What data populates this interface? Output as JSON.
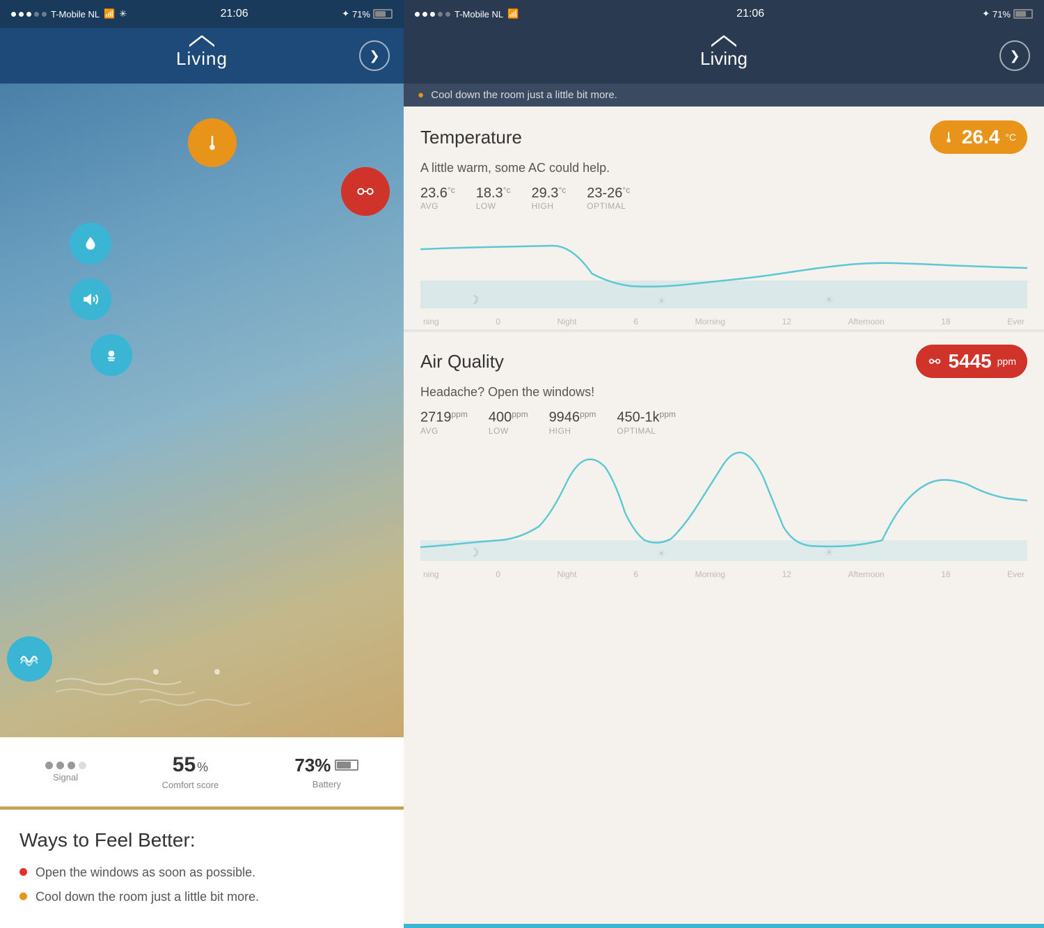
{
  "left": {
    "status": {
      "carrier": "T-Mobile NL",
      "time": "21:06",
      "battery": "71%"
    },
    "header": {
      "title": "Living",
      "chevron": "❯"
    },
    "sensors": {
      "temp_label": "thermometer",
      "co2_label": "co2",
      "humidity_label": "droplet",
      "sound_label": "speaker",
      "light_label": "bulb",
      "wave_label": "wave"
    },
    "stats": {
      "signal_label": "Signal",
      "comfort_value": "55",
      "comfort_unit": "%",
      "comfort_label": "Comfort score",
      "battery_value": "73%",
      "battery_label": "Battery"
    },
    "ways": {
      "title": "Ways to Feel Better:",
      "items": [
        {
          "text": "Open the windows as soon as possible.",
          "color": "red"
        },
        {
          "text": "Cool down the room just a little bit more.",
          "color": "orange"
        }
      ]
    }
  },
  "right": {
    "status": {
      "carrier": "T-Mobile NL",
      "time": "21:06",
      "battery": "71%"
    },
    "header": {
      "title": "Living",
      "chevron": "❯"
    },
    "notification": "Cool down the room just a little bit more.",
    "temperature": {
      "title": "Temperature",
      "badge_value": "26.4",
      "badge_unit": "°C",
      "description": "A little warm, some AC could help.",
      "stats": [
        {
          "value": "23.6",
          "unit": "°c",
          "label": "AVG"
        },
        {
          "value": "18.3",
          "unit": "°c",
          "label": "LOW"
        },
        {
          "value": "29.3",
          "unit": "°c",
          "label": "HIGH"
        },
        {
          "value": "23-26",
          "unit": "°c",
          "label": "OPTIMAL"
        }
      ],
      "chart_axis": [
        "ning",
        "0",
        "Night",
        "6",
        "Morning",
        "12",
        "Afternoon",
        "18",
        "Ever"
      ]
    },
    "airquality": {
      "title": "Air Quality",
      "badge_value": "5445",
      "badge_unit": "ppm",
      "description": "Headache? Open the windows!",
      "stats": [
        {
          "value": "2719",
          "unit": "ppm",
          "label": "AVG"
        },
        {
          "value": "400",
          "unit": "ppm",
          "label": "LOW"
        },
        {
          "value": "9946",
          "unit": "ppm",
          "label": "HIGH"
        },
        {
          "value": "450-1k",
          "unit": "ppm",
          "label": "OPTIMAL"
        }
      ],
      "chart_axis": [
        "ning",
        "0",
        "Night",
        "6",
        "Morning",
        "12",
        "Afternoon",
        "18",
        "Ever"
      ]
    }
  }
}
